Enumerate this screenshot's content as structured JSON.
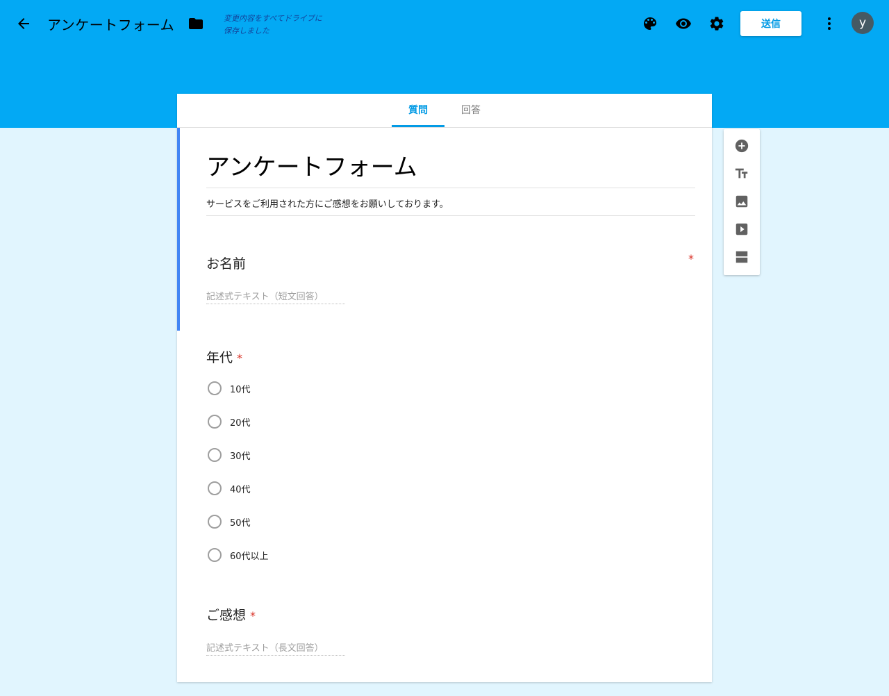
{
  "header": {
    "title": "アンケートフォーム",
    "save_status_line1": "変更内容をすべてドライブに",
    "save_status_line2": "保存しました",
    "send_label": "送信",
    "avatar_letter": "y",
    "icons": [
      "arrow-back-icon",
      "folder-icon",
      "palette-icon",
      "eye-icon",
      "gear-icon",
      "more-vert-icon"
    ]
  },
  "tabs": [
    {
      "label": "質問",
      "active": true
    },
    {
      "label": "回答",
      "active": false
    }
  ],
  "form": {
    "title": "アンケートフォーム",
    "description": "サービスをご利用された方にご感想をお願いしております。"
  },
  "questions": [
    {
      "title": "お名前",
      "required": true,
      "type": "short-text",
      "placeholder": "記述式テキスト（短文回答）"
    },
    {
      "title": "年代",
      "required": true,
      "type": "multiple-choice",
      "options": [
        "10代",
        "20代",
        "30代",
        "40代",
        "50代",
        "60代以上"
      ]
    },
    {
      "title": "ご感想",
      "required": true,
      "type": "paragraph",
      "placeholder": "記述式テキスト（長文回答）"
    }
  ],
  "required_mark": "*",
  "side_toolbar": [
    "add-question-icon",
    "title-text-icon",
    "image-icon",
    "video-icon",
    "section-icon"
  ],
  "colors": {
    "header_bg": "#03a9f4",
    "page_bg": "#e1f5fe",
    "accent": "#039be5",
    "required": "#d93025"
  }
}
